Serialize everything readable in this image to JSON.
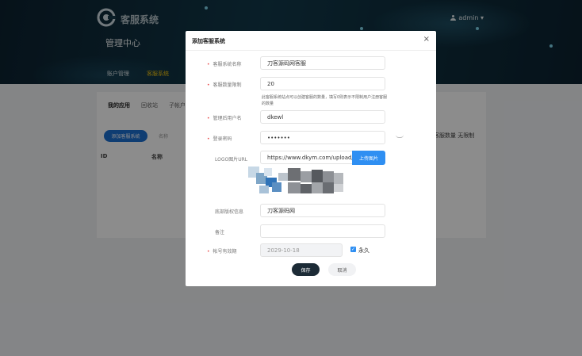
{
  "header": {
    "logo_text": "客服系统",
    "app_title": "管理中心",
    "nav": [
      "账户管理",
      "客服系统"
    ],
    "user": "admin ▾"
  },
  "background": {
    "tabs": [
      "我的应用",
      "回收站",
      "子帐户"
    ],
    "add_button": "添加客服系统",
    "name_label": "名称",
    "columns": {
      "id": "ID",
      "name": "名称",
      "limit": "客服数量 无限制"
    }
  },
  "modal": {
    "title": "添加客服系统",
    "close": "×",
    "fields": {
      "system_name": {
        "label": "客服系统名称",
        "value": "刀客源码网客服"
      },
      "seat_count": {
        "label": "客服数量限制",
        "value": "20",
        "hint": "此客服系统站点可以创建客服的数量，填写0则表示不限制用户注册客服的数量"
      },
      "admin_user": {
        "label": "管理后用户名",
        "value": "dkewl"
      },
      "password": {
        "label": "登录密码",
        "value": "•••••••"
      },
      "logo_url": {
        "label": "LOGO图片URL",
        "value": "https://www.dkym.com/upload/i",
        "button": "上传图片"
      },
      "footer": {
        "label": "底部版权信息",
        "value": "刀客源码网"
      },
      "note": {
        "label": "备注",
        "value": ""
      },
      "expiry": {
        "label": "帐号有效期",
        "value": "2029-10-18",
        "checkbox": "永久"
      }
    },
    "save": "保存",
    "cancel": "取消"
  },
  "colors": {
    "primary": "#2f8ff2",
    "dark_button": "#1c2b36",
    "required": "#e84848",
    "nav_active": "#f1c40f"
  }
}
